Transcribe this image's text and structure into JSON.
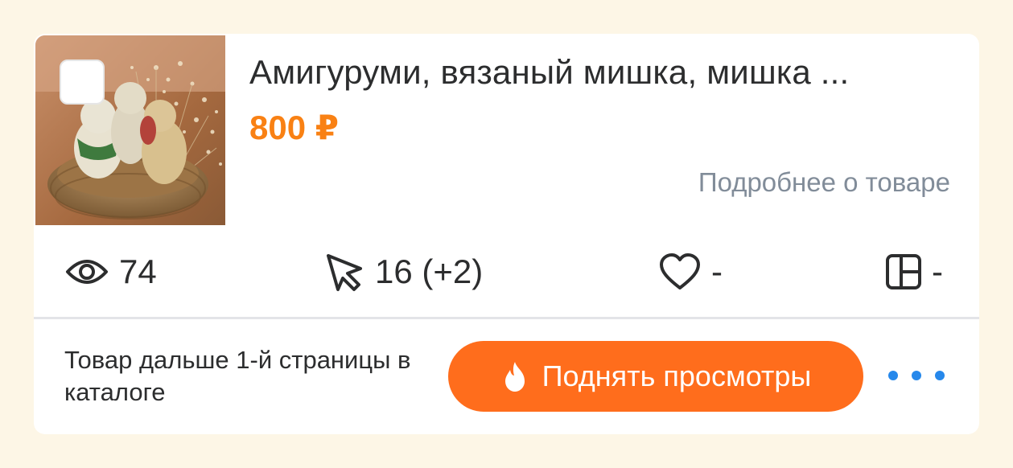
{
  "product": {
    "title": "Амигуруми, вязаный мишка, мишка ...",
    "price": "800 ₽",
    "details_link": "Подробнее о товаре",
    "image_icon": "knitted-bears-in-basket-photo"
  },
  "stats": {
    "views": "74",
    "clicks": "16 (+2)",
    "favorites": "-",
    "collections": "-"
  },
  "footer": {
    "note": "Товар дальше 1-й страницы в каталоге",
    "boost_label": "Поднять просмотры",
    "boost_icon": "fire-icon",
    "more_icon": "more-dots-icon"
  },
  "colors": {
    "accent_orange": "#ff6d1c",
    "price_orange": "#f98114",
    "link_gray": "#818c99",
    "dots_blue": "#2688eb",
    "background": "#fdf6e6"
  }
}
